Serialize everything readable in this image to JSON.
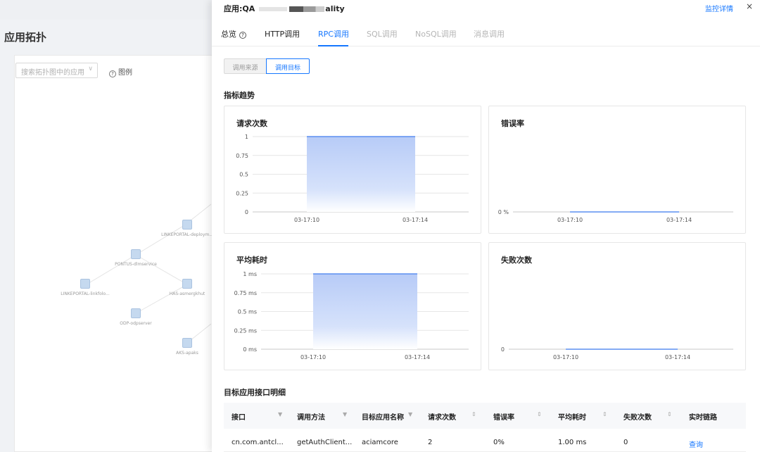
{
  "background": {
    "page_title": "应用拓扑",
    "search_placeholder": "搜索拓扑图中的应用",
    "legend_label": "图例",
    "nodes": [
      {
        "label": "LINKEPORTAL-deploym..."
      },
      {
        "label": "PONTUS-dlmservice"
      },
      {
        "label": "LINKEPORTAL-linkfolo..."
      },
      {
        "label": "HAS-asmergkhut"
      },
      {
        "label": "ODP-odpserver"
      },
      {
        "label": "AKS-apaks"
      }
    ]
  },
  "drawer": {
    "title_prefix": "应用:QA",
    "title_suffix": "ality",
    "detail_link": "监控详情",
    "close_icon": "×",
    "tabs": [
      {
        "label": "总览",
        "state": "normal",
        "help_icon": "?"
      },
      {
        "label": "HTTP调用",
        "state": "normal"
      },
      {
        "label": "RPC调用",
        "state": "active"
      },
      {
        "label": "SQL调用",
        "state": "disabled"
      },
      {
        "label": "NoSQL调用",
        "state": "disabled"
      },
      {
        "label": "消息调用",
        "state": "disabled"
      }
    ],
    "segment": {
      "source": "调用来源",
      "target": "调用目标",
      "selected": "target"
    },
    "trend_title": "指标趋势",
    "table_title": "目标应用接口明细"
  },
  "accent_color": "#1677ff",
  "chart_data": [
    {
      "type": "area",
      "title": "请求次数",
      "x": [
        "03-17:10",
        "03-17:14"
      ],
      "y_ticks": [
        "0",
        "0.25",
        "0.5",
        "0.75",
        "1"
      ],
      "ylim": [
        0,
        1
      ],
      "series": [
        {
          "values": [
            1,
            1
          ]
        }
      ]
    },
    {
      "type": "line",
      "title": "错误率",
      "x": [
        "03-17:10",
        "03-17:14"
      ],
      "y_ticks": [
        "0 %"
      ],
      "series": [
        {
          "values": [
            0,
            0
          ]
        }
      ]
    },
    {
      "type": "area",
      "title": "平均耗时",
      "x": [
        "03-17:10",
        "03-17:14"
      ],
      "y_ticks": [
        "0 ms",
        "0.25 ms",
        "0.5 ms",
        "0.75 ms",
        "1 ms"
      ],
      "ylim": [
        0,
        1
      ],
      "series": [
        {
          "values": [
            1,
            1
          ]
        }
      ]
    },
    {
      "type": "line",
      "title": "失败次数",
      "x": [
        "03-17:10",
        "03-17:14"
      ],
      "y_ticks": [
        "0"
      ],
      "series": [
        {
          "values": [
            0,
            0
          ]
        }
      ]
    }
  ],
  "table": {
    "columns": [
      {
        "label": "接口",
        "icon": "filter-icon"
      },
      {
        "label": "调用方法",
        "icon": "filter-icon"
      },
      {
        "label": "目标应用名称",
        "icon": "filter-icon"
      },
      {
        "label": "请求次数",
        "icon": "sort-icon"
      },
      {
        "label": "错误率",
        "icon": "sort-icon"
      },
      {
        "label": "平均耗时",
        "icon": "sort-icon"
      },
      {
        "label": "失败次数",
        "icon": "sort-icon"
      },
      {
        "label": "实时链路"
      }
    ],
    "rows": [
      [
        "cn.com.antcl...",
        "getAuthClient...",
        "aciamcore",
        "2",
        "0%",
        "1.00 ms",
        "0",
        "查询"
      ]
    ]
  }
}
